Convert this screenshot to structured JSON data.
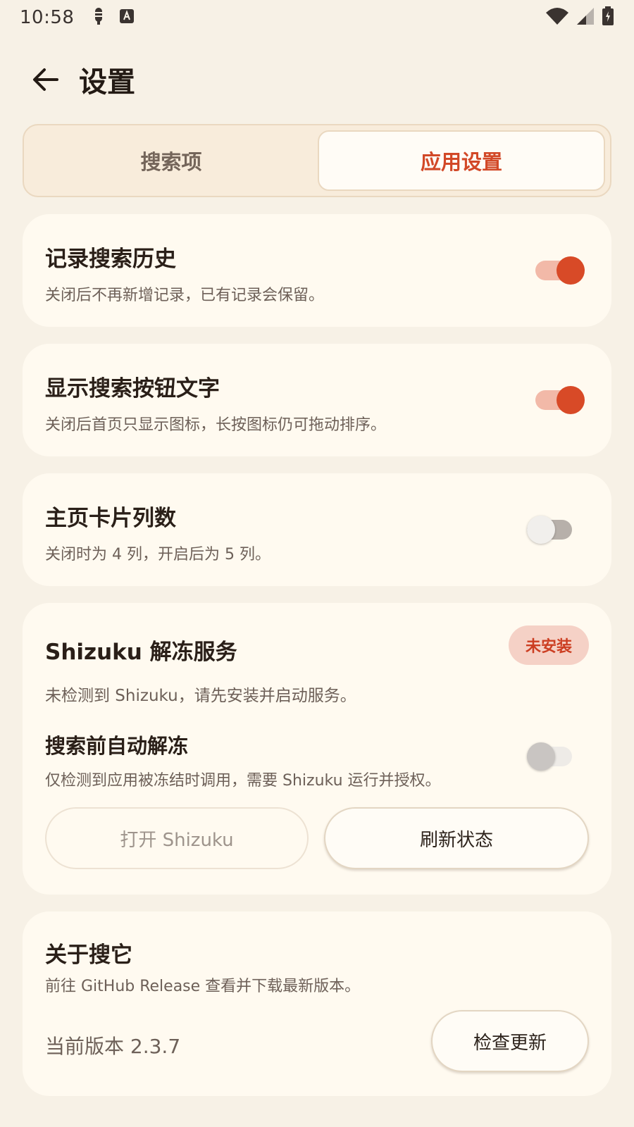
{
  "status_bar": {
    "time": "10:58",
    "left_icons": [
      "notification-icon",
      "text-icon"
    ],
    "right_icons": [
      "wifi-icon",
      "signal-icon",
      "battery-icon"
    ]
  },
  "app_bar": {
    "title": "设置"
  },
  "tabs": [
    {
      "label": "搜索项",
      "active": false
    },
    {
      "label": "应用设置",
      "active": true
    }
  ],
  "settings": {
    "history": {
      "title": "记录搜索历史",
      "subtitle": "关闭后不再新增记录，已有记录会保留。",
      "enabled": true
    },
    "button_text": {
      "title": "显示搜索按钮文字",
      "subtitle": "关闭后首页只显示图标，长按图标仍可拖动排序。",
      "enabled": true
    },
    "columns": {
      "title": "主页卡片列数",
      "subtitle": "关闭时为 4 列，开启后为 5 列。",
      "enabled": false
    }
  },
  "shizuku": {
    "title": "Shizuku 解冻服务",
    "badge": "未安装",
    "description": "未检测到 Shizuku，请先安装并启动服务。",
    "auto_unfreeze": {
      "title": "搜索前自动解冻",
      "subtitle": "仅检测到应用被冻结时调用，需要 Shizuku 运行并授权。",
      "enabled": false
    },
    "open_button": "打开 Shizuku",
    "refresh_button": "刷新状态"
  },
  "about": {
    "title": "关于搜它",
    "subtitle": "前往 GitHub Release 查看并下载最新版本。",
    "version_label": "当前版本 2.3.7",
    "check_update_button": "检查更新"
  },
  "colors": {
    "background": "#f7f1e6",
    "card": "#fffaf0",
    "accent": "#d84a27",
    "badge_bg": "#f5d1c6"
  }
}
